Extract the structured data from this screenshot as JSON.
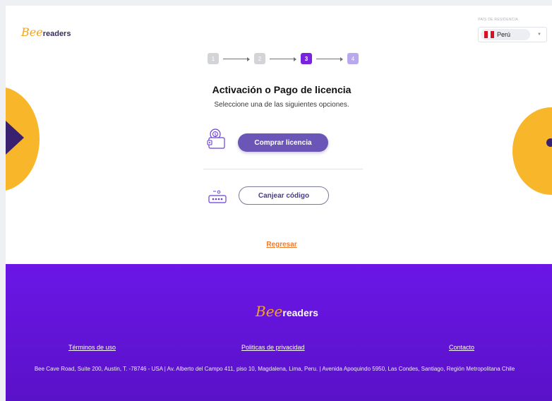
{
  "header": {
    "logo_bee": "Bee",
    "logo_readers": "readers",
    "country_label": "PAÍS DE RESIDENCIA",
    "country_value": "Perú"
  },
  "stepper": {
    "steps": [
      "1",
      "2",
      "3",
      "4"
    ],
    "current_step": 3
  },
  "main": {
    "title": "Activación o Pago de licencia",
    "subtitle": "Seleccione una de las siguientes opciones.",
    "buy_label": "Comprar licencia",
    "redeem_label": "Canjear código",
    "back_label": "Regresar"
  },
  "footer": {
    "logo_bee": "Bee",
    "logo_readers": "readers",
    "terms": "Términos de uso",
    "privacy": "Politicas de privacidad",
    "contact": "Contacto",
    "address": "Bee Cave Road, Suite 200, Austin, T. -78746 - USA | Av. Alberto del Campo 411, piso 10, Magdalena, Lima, Peru. | Avenida Apoquindo 5950, Las Condes, Santiago, Región Metropolitana Chile"
  },
  "colors": {
    "accent": "#7a22e0",
    "button": "#6b55b6",
    "link": "#ef7a2c",
    "yellow": "#f8b62a",
    "footer": "#6a16e6"
  },
  "icons": {
    "wallet": "wallet-icon",
    "keypad": "keypad-icon",
    "arrow": "arrow-right-icon"
  }
}
